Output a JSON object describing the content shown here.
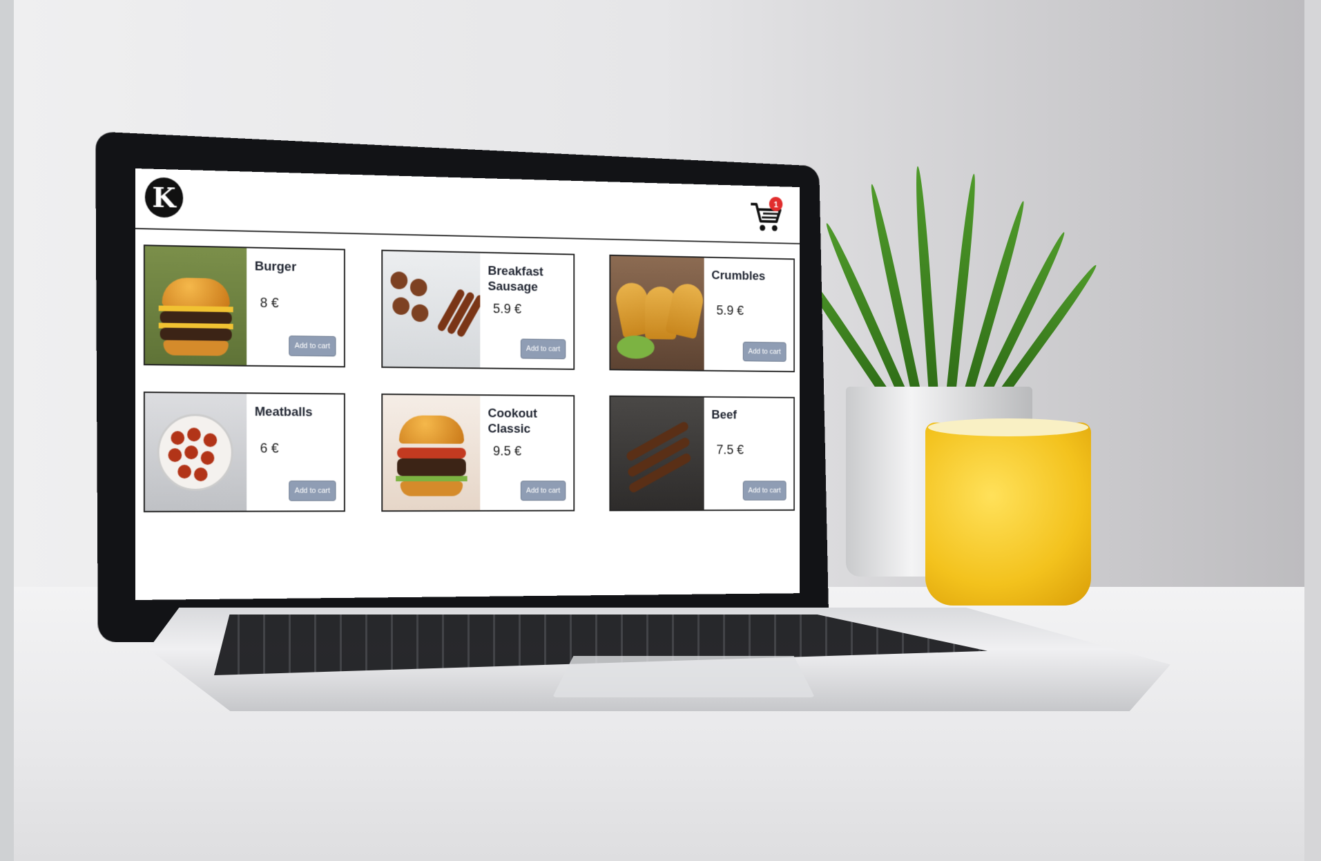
{
  "app": {
    "logo_text": "K",
    "cart": {
      "icon": "cart-icon",
      "count": "1",
      "badge_color": "#e12d2d"
    }
  },
  "products": [
    {
      "name": "Burger",
      "price": "8 €",
      "button": "Add to cart",
      "image": "burger-image"
    },
    {
      "name": "Breakfast Sausage",
      "price": "5.9 €",
      "button": "Add to cart",
      "image": "sausage-image"
    },
    {
      "name": "Crumbles",
      "price": "5.9 €",
      "button": "Add to cart",
      "image": "tacos-image"
    },
    {
      "name": "Meatballs",
      "price": "6 €",
      "button": "Add to cart",
      "image": "meatballs-image"
    },
    {
      "name": "Cookout Classic",
      "price": "9.5 €",
      "button": "Add to cart",
      "image": "burger-image"
    },
    {
      "name": "Beef",
      "price": "7.5 €",
      "button": "Add to cart",
      "image": "kebab-image"
    }
  ],
  "colors": {
    "button_bg": "#8f9db4",
    "accent_red": "#e12d2d"
  }
}
